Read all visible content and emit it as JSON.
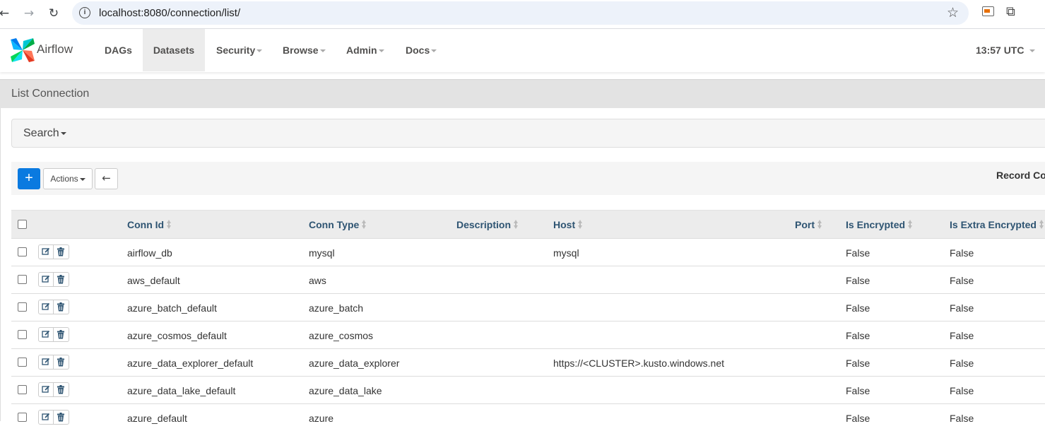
{
  "browser": {
    "url": "localhost:8080/connection/list/"
  },
  "navbar": {
    "brand": "Airflow",
    "items": [
      {
        "label": "DAGs"
      },
      {
        "label": "Datasets"
      },
      {
        "label": "Security"
      },
      {
        "label": "Browse"
      },
      {
        "label": "Admin"
      },
      {
        "label": "Docs"
      }
    ],
    "active": "Datasets",
    "clock": "13:57 UTC"
  },
  "page": {
    "title": "List Connection"
  },
  "search": {
    "label": "Search"
  },
  "toolbar": {
    "add_label": "+",
    "actions_label": "Actions",
    "back_label": "←",
    "record_count_label": "Record Co"
  },
  "table": {
    "columns": [
      "Conn Id",
      "Conn Type",
      "Description",
      "Host",
      "Port",
      "Is Encrypted",
      "Is Extra Encrypted"
    ],
    "rows": [
      {
        "conn_id": "airflow_db",
        "conn_type": "mysql",
        "description": "",
        "host": "mysql",
        "port": "",
        "is_encrypted": "False",
        "is_extra_encrypted": "False"
      },
      {
        "conn_id": "aws_default",
        "conn_type": "aws",
        "description": "",
        "host": "",
        "port": "",
        "is_encrypted": "False",
        "is_extra_encrypted": "False"
      },
      {
        "conn_id": "azure_batch_default",
        "conn_type": "azure_batch",
        "description": "",
        "host": "",
        "port": "",
        "is_encrypted": "False",
        "is_extra_encrypted": "False"
      },
      {
        "conn_id": "azure_cosmos_default",
        "conn_type": "azure_cosmos",
        "description": "",
        "host": "",
        "port": "",
        "is_encrypted": "False",
        "is_extra_encrypted": "False"
      },
      {
        "conn_id": "azure_data_explorer_default",
        "conn_type": "azure_data_explorer",
        "description": "",
        "host": "https://<CLUSTER>.kusto.windows.net",
        "port": "",
        "is_encrypted": "False",
        "is_extra_encrypted": "False"
      },
      {
        "conn_id": "azure_data_lake_default",
        "conn_type": "azure_data_lake",
        "description": "",
        "host": "",
        "port": "",
        "is_encrypted": "False",
        "is_extra_encrypted": "False"
      },
      {
        "conn_id": "azure_default",
        "conn_type": "azure",
        "description": "",
        "host": "",
        "port": "",
        "is_encrypted": "False",
        "is_extra_encrypted": "False"
      }
    ]
  },
  "colors": {
    "accent": "#0a7ae0",
    "header_text": "#2e5472",
    "nav_text": "#51504f"
  }
}
